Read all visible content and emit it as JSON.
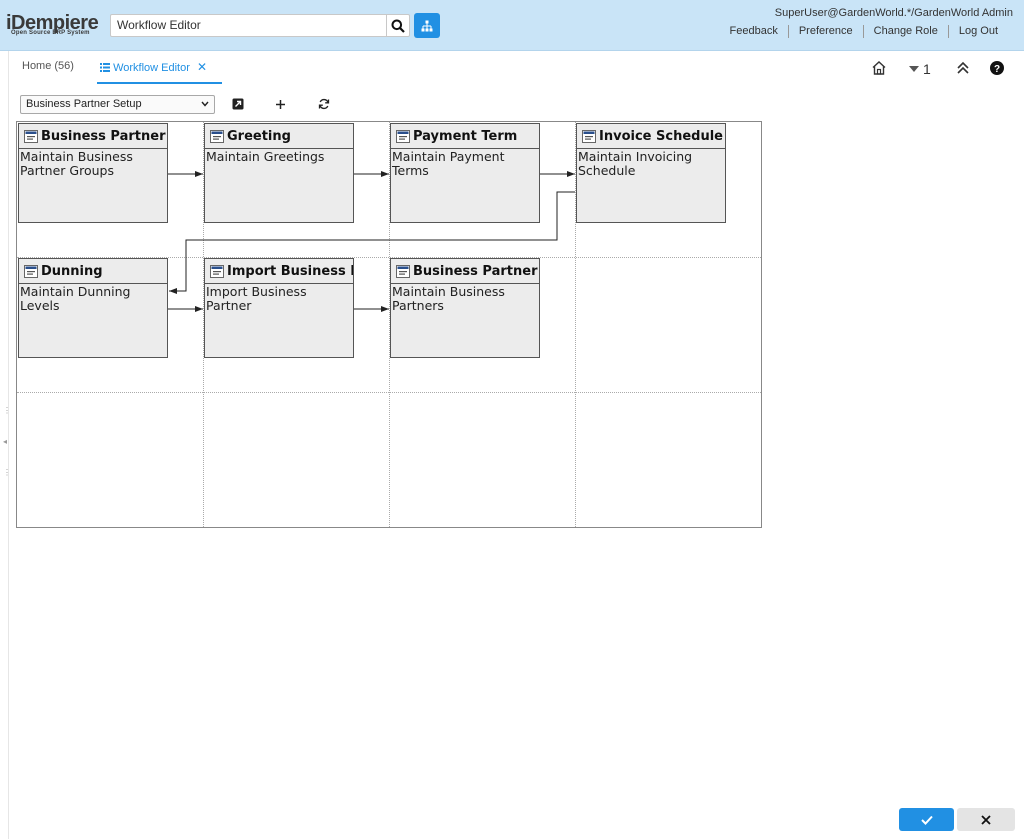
{
  "header": {
    "logo_text": "iDempiere",
    "logo_sub": "Open Source ERP System",
    "search_value": "Workflow Editor",
    "user": "SuperUser@GardenWorld.*/GardenWorld Admin",
    "links": [
      "Feedback",
      "Preference",
      "Change Role",
      "Log Out"
    ]
  },
  "tabs": {
    "home": "Home (56)",
    "workflow": "Workflow Editor"
  },
  "top_icons": {
    "badge_count": "1"
  },
  "toolbar": {
    "workflow_selected": "Business Partner Setup"
  },
  "nodes": [
    {
      "title": "Business Partner Group",
      "desc": "Maintain Business Partner Groups"
    },
    {
      "title": "Greeting",
      "desc": "Maintain Greetings"
    },
    {
      "title": "Payment Term",
      "desc": "Maintain Payment Terms"
    },
    {
      "title": "Invoice Schedule",
      "desc": "Maintain Invoicing Schedule"
    },
    {
      "title": "Dunning",
      "desc": "Maintain Dunning Levels"
    },
    {
      "title": "Import Business Partner",
      "desc": "Import Business Partner"
    },
    {
      "title": "Business Partner",
      "desc": "Maintain Business Partners"
    }
  ],
  "colors": {
    "accent": "#2190e3",
    "header_bg": "#c9e4f7",
    "node_bg": "#ececec"
  }
}
